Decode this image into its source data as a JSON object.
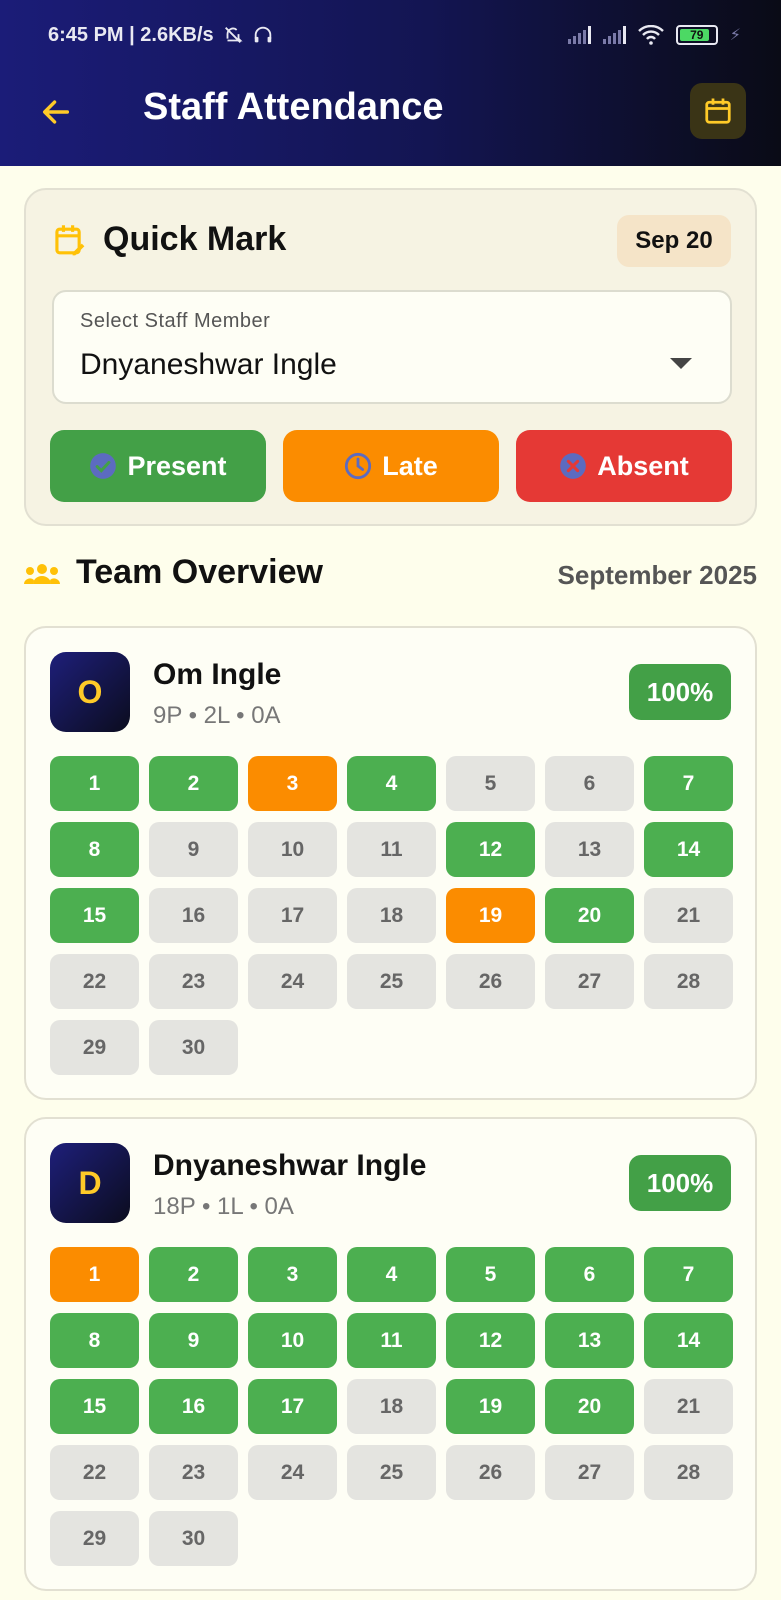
{
  "status_bar": {
    "time_speed": "6:45 PM | 2.6KB/s",
    "battery": "79"
  },
  "app_bar": {
    "title": "Staff Attendance",
    "back_icon": "arrow-left-icon",
    "calendar_icon": "calendar-icon"
  },
  "quick_mark": {
    "title": "Quick Mark",
    "date": "Sep 20",
    "select_label": "Select Staff Member",
    "selected_staff": "Dnyaneshwar Ingle",
    "buttons": {
      "present": "Present",
      "late": "Late",
      "absent": "Absent"
    }
  },
  "team_overview": {
    "title": "Team Overview",
    "month": "September 2025"
  },
  "colors": {
    "present": "#4caf50",
    "late": "#fb8c00",
    "absent": "#e53935",
    "none": "#e4e4e0",
    "accent": "#ffca28"
  },
  "staff": [
    {
      "initial": "O",
      "name": "Om Ingle",
      "summary": "9P • 2L • 0A",
      "percent": "100%",
      "days": [
        {
          "d": "1",
          "s": "present"
        },
        {
          "d": "2",
          "s": "present"
        },
        {
          "d": "3",
          "s": "late"
        },
        {
          "d": "4",
          "s": "present"
        },
        {
          "d": "5",
          "s": "none"
        },
        {
          "d": "6",
          "s": "none"
        },
        {
          "d": "7",
          "s": "present"
        },
        {
          "d": "8",
          "s": "present"
        },
        {
          "d": "9",
          "s": "none"
        },
        {
          "d": "10",
          "s": "none"
        },
        {
          "d": "11",
          "s": "none"
        },
        {
          "d": "12",
          "s": "present"
        },
        {
          "d": "13",
          "s": "none"
        },
        {
          "d": "14",
          "s": "present"
        },
        {
          "d": "15",
          "s": "present"
        },
        {
          "d": "16",
          "s": "none"
        },
        {
          "d": "17",
          "s": "none"
        },
        {
          "d": "18",
          "s": "none"
        },
        {
          "d": "19",
          "s": "late"
        },
        {
          "d": "20",
          "s": "present"
        },
        {
          "d": "21",
          "s": "none"
        },
        {
          "d": "22",
          "s": "none"
        },
        {
          "d": "23",
          "s": "none"
        },
        {
          "d": "24",
          "s": "none"
        },
        {
          "d": "25",
          "s": "none"
        },
        {
          "d": "26",
          "s": "none"
        },
        {
          "d": "27",
          "s": "none"
        },
        {
          "d": "28",
          "s": "none"
        },
        {
          "d": "29",
          "s": "none"
        },
        {
          "d": "30",
          "s": "none"
        }
      ]
    },
    {
      "initial": "D",
      "name": "Dnyaneshwar Ingle",
      "summary": "18P • 1L • 0A",
      "percent": "100%",
      "days": [
        {
          "d": "1",
          "s": "late"
        },
        {
          "d": "2",
          "s": "present"
        },
        {
          "d": "3",
          "s": "present"
        },
        {
          "d": "4",
          "s": "present"
        },
        {
          "d": "5",
          "s": "present"
        },
        {
          "d": "6",
          "s": "present"
        },
        {
          "d": "7",
          "s": "present"
        },
        {
          "d": "8",
          "s": "present"
        },
        {
          "d": "9",
          "s": "present"
        },
        {
          "d": "10",
          "s": "present"
        },
        {
          "d": "11",
          "s": "present"
        },
        {
          "d": "12",
          "s": "present"
        },
        {
          "d": "13",
          "s": "present"
        },
        {
          "d": "14",
          "s": "present"
        },
        {
          "d": "15",
          "s": "present"
        },
        {
          "d": "16",
          "s": "present"
        },
        {
          "d": "17",
          "s": "present"
        },
        {
          "d": "18",
          "s": "none"
        },
        {
          "d": "19",
          "s": "present"
        },
        {
          "d": "20",
          "s": "present"
        },
        {
          "d": "21",
          "s": "none"
        },
        {
          "d": "22",
          "s": "none"
        },
        {
          "d": "23",
          "s": "none"
        },
        {
          "d": "24",
          "s": "none"
        },
        {
          "d": "25",
          "s": "none"
        },
        {
          "d": "26",
          "s": "none"
        },
        {
          "d": "27",
          "s": "none"
        },
        {
          "d": "28",
          "s": "none"
        },
        {
          "d": "29",
          "s": "none"
        },
        {
          "d": "30",
          "s": "none"
        }
      ]
    }
  ]
}
